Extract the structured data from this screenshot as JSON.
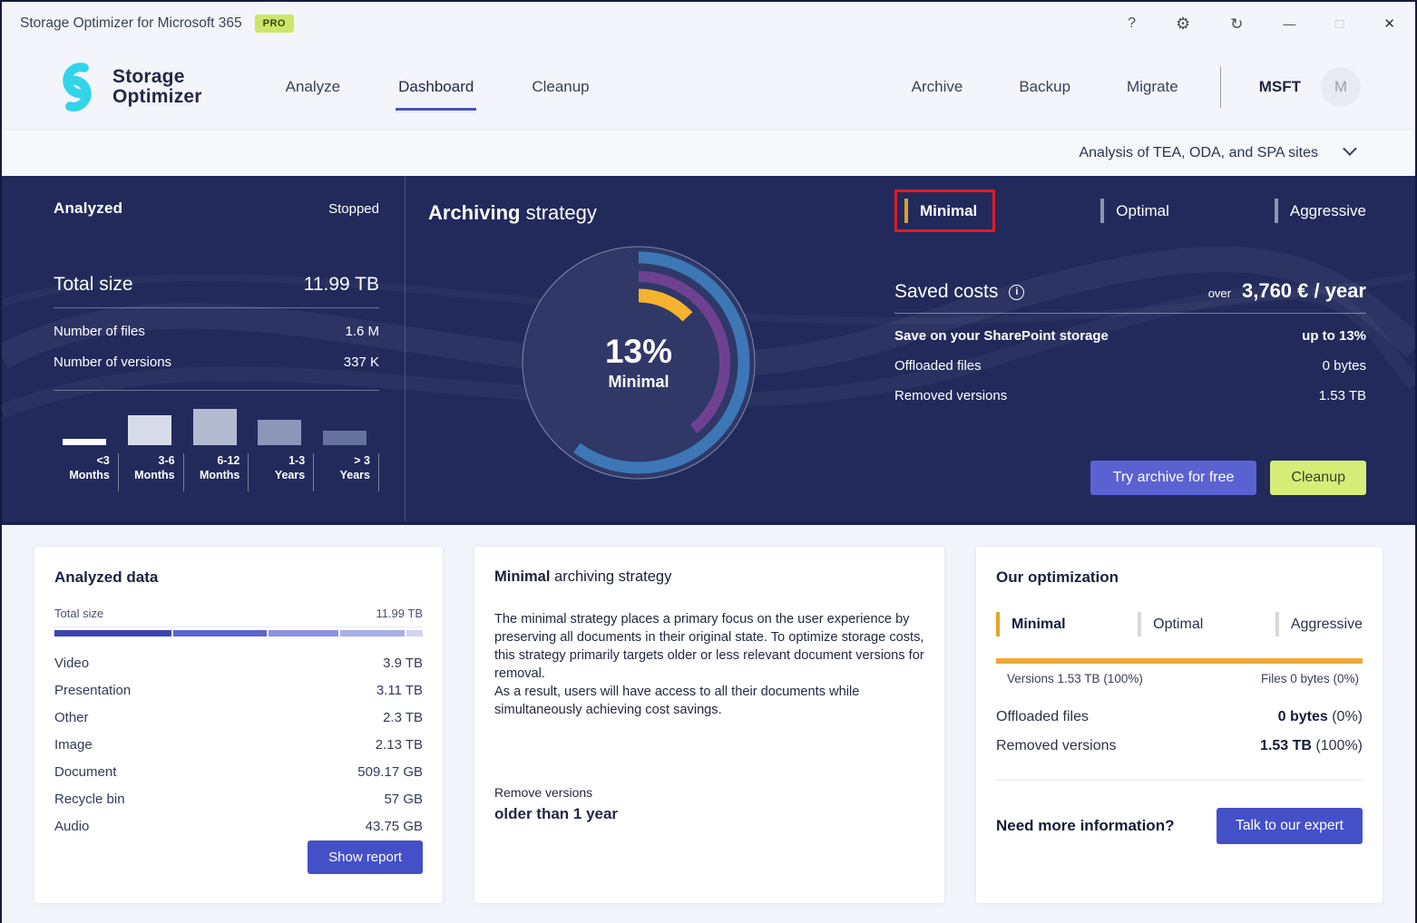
{
  "colors": {
    "accent_indigo": "#4a52c5",
    "button_indigo": "#4350c7",
    "hero_button_indigo": "#5a62d2",
    "lime": "#d6ee78",
    "pro_badge": "#cbe767",
    "gold": "#e4a427",
    "hero_bg": "#212a5b",
    "brand_cyan": "#31d4ea",
    "annotation_red": "#e31a22"
  },
  "titlebar": {
    "title": "Storage Optimizer for Microsoft 365",
    "badge": "PRO",
    "controls": [
      {
        "name": "help",
        "glyph": "?"
      },
      {
        "name": "settings",
        "glyph": "⚙"
      },
      {
        "name": "refresh",
        "glyph": "↻"
      },
      {
        "name": "minimize",
        "glyph": "—"
      },
      {
        "name": "maximize",
        "glyph": "□"
      },
      {
        "name": "close",
        "glyph": "✕"
      }
    ]
  },
  "nav": {
    "logo_line1": "Storage",
    "logo_line2": "Optimizer",
    "tabs": [
      {
        "label": "Analyze",
        "active": false
      },
      {
        "label": "Dashboard",
        "active": true
      },
      {
        "label": "Cleanup",
        "active": false
      }
    ],
    "right_tabs": [
      "Archive",
      "Backup",
      "Migrate"
    ],
    "tenant": "MSFT",
    "avatar_letter": "M"
  },
  "site_selector": {
    "label": "Analysis of TEA, ODA, and SPA sites"
  },
  "hero": {
    "analyzed": {
      "title": "Analyzed",
      "status": "Stopped",
      "total_label": "Total size",
      "total_value": "11.99 TB",
      "rows": [
        {
          "label": "Number of files",
          "value": "1.6 M"
        },
        {
          "label": "Number of versions",
          "value": "337 K"
        }
      ],
      "age_chart": {
        "bars": [
          {
            "line1": "<3",
            "line2": "Months",
            "rel": 0.15,
            "color": "#ffffff"
          },
          {
            "line1": "3-6",
            "line2": "Months",
            "rel": 0.72,
            "color": "#d7dbe8"
          },
          {
            "line1": "6-12",
            "line2": "Months",
            "rel": 0.88,
            "color": "#b3bbd1"
          },
          {
            "line1": "1-3",
            "line2": "Years",
            "rel": 0.6,
            "color": "#8c97b8"
          },
          {
            "line1": "> 3",
            "line2": "Years",
            "rel": 0.34,
            "color": "#64719c"
          }
        ]
      }
    },
    "strategy": {
      "title_bold": "Archiving",
      "title_rest": " strategy",
      "donut": {
        "percent": "13%",
        "name": "Minimal"
      },
      "tabs": [
        {
          "label": "Minimal",
          "active": true,
          "annotated": true
        },
        {
          "label": "Optimal",
          "active": false,
          "annotated": false
        },
        {
          "label": "Aggressive",
          "active": false,
          "annotated": false
        }
      ]
    },
    "saved_costs": {
      "title": "Saved costs",
      "info_glyph": "i",
      "over_label": "over",
      "amount": "3,760 € / year",
      "rows": [
        {
          "label": "Save on your SharePoint storage",
          "value": "up to 13%",
          "bold": true
        },
        {
          "label": "Offloaded files",
          "value": "0 bytes",
          "bold": false
        },
        {
          "label": "Removed versions",
          "value": "1.53 TB",
          "bold": false
        }
      ],
      "archive_button": "Try archive for free",
      "cleanup_button": "Cleanup"
    }
  },
  "cards": {
    "analyzed_data": {
      "title": "Analyzed data",
      "total_label": "Total size",
      "total_value": "11.99 TB",
      "segments": [
        {
          "pct": 32.5,
          "color": "#3a45b2"
        },
        {
          "pct": 25.9,
          "color": "#5a65d1"
        },
        {
          "pct": 19.2,
          "color": "#8a92e0"
        },
        {
          "pct": 17.8,
          "color": "#a8afe9"
        },
        {
          "pct": 4.6,
          "color": "#d2d5f3"
        }
      ],
      "rows": [
        {
          "label": "Video",
          "value": "3.9 TB"
        },
        {
          "label": "Presentation",
          "value": "3.11 TB"
        },
        {
          "label": "Other",
          "value": "2.3 TB"
        },
        {
          "label": "Image",
          "value": "2.13 TB"
        },
        {
          "label": "Document",
          "value": "509.17 GB"
        },
        {
          "label": "Recycle bin",
          "value": "57 GB"
        },
        {
          "label": "Audio",
          "value": "43.75 GB"
        }
      ],
      "button": "Show report"
    },
    "strategy_info": {
      "title_bold": "Minimal",
      "title_rest": " archiving strategy",
      "paragraph1": "The minimal strategy places a primary focus on the user experience by preserving all documents in their original state. To optimize storage costs, this strategy primarily targets older or less relevant document versions for removal.",
      "paragraph2": "As a result, users will have access to all their documents while simultaneously achieving cost savings.",
      "remove_label": "Remove versions",
      "remove_value": "older than 1 year"
    },
    "optimization": {
      "title": "Our optimization",
      "tabs": [
        {
          "label": "Minimal",
          "active": true
        },
        {
          "label": "Optimal",
          "active": false
        },
        {
          "label": "Aggressive",
          "active": false
        }
      ],
      "split_left": "Versions 1.53 TB (100%)",
      "split_right": "Files 0 bytes (0%)",
      "rows": [
        {
          "label": "Offloaded files",
          "value_bold": "0 bytes",
          "value_rest": " (0%)"
        },
        {
          "label": "Removed versions",
          "value_bold": "1.53 TB",
          "value_rest": " (100%)"
        }
      ],
      "footer_label": "Need more information?",
      "button": "Talk to our expert"
    }
  },
  "chart_data": [
    {
      "id": "file_age_distribution",
      "type": "bar",
      "title": "Analyzed file age distribution",
      "categories": [
        "<3 Months",
        "3-6 Months",
        "6-12 Months",
        "1-3 Years",
        "> 3 Years"
      ],
      "values_relative": [
        0.15,
        0.72,
        0.88,
        0.6,
        0.34
      ],
      "colors": [
        "#ffffff",
        "#d7dbe8",
        "#b3bbd1",
        "#8c97b8",
        "#64719c"
      ],
      "note": "y-axis unlabeled; relative bar heights estimated from pixels"
    },
    {
      "id": "strategy_donut",
      "type": "pie",
      "center_label": "13%",
      "center_sublabel": "Minimal",
      "legend_position": "none",
      "series": [
        {
          "name": "outer-ring",
          "sweep_pct": 60,
          "color": "#3d77b5"
        },
        {
          "name": "middle-ring",
          "sweep_pct": 39,
          "color": "#6e4190"
        },
        {
          "name": "minimal-savings",
          "sweep_pct": 13,
          "color": "#f6b330"
        }
      ],
      "start_angle_deg": 0,
      "direction": "clockwise"
    },
    {
      "id": "analyzed_data_breakdown",
      "type": "bar",
      "title": "Analyzed data by type",
      "categories": [
        "Video",
        "Presentation",
        "Other",
        "Image",
        "Document",
        "Recycle bin",
        "Audio"
      ],
      "values": [
        "3.9 TB",
        "3.11 TB",
        "2.3 TB",
        "2.13 TB",
        "509.17 GB",
        "57 GB",
        "43.75 GB"
      ],
      "total": "11.99 TB",
      "segment_pcts": [
        32.5,
        25.9,
        19.2,
        17.8,
        4.6
      ]
    },
    {
      "id": "optimization_split",
      "type": "bar",
      "categories": [
        "Versions",
        "Files"
      ],
      "values": [
        "1.53 TB (100%)",
        "0 bytes (0%)"
      ],
      "color": "#f1a937"
    }
  ]
}
